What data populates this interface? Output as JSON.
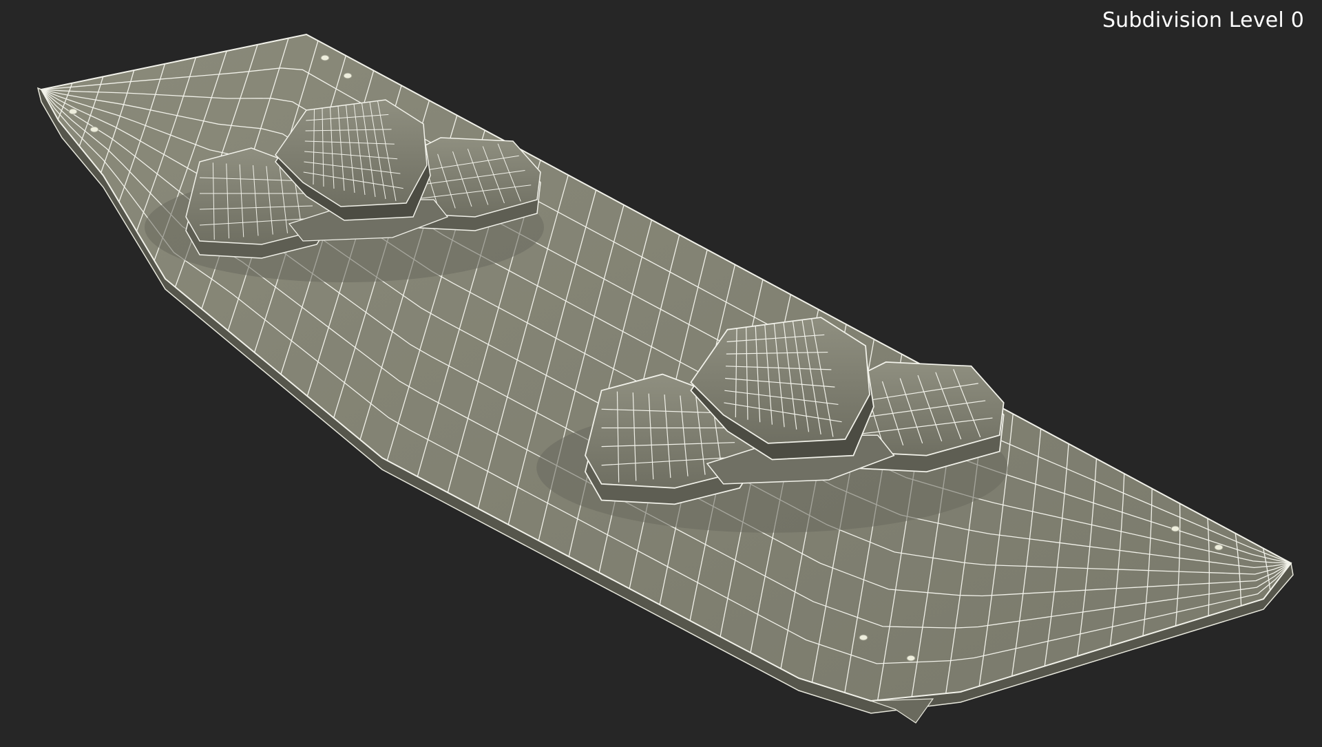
{
  "viewport": {
    "overlay_label": "Subdivision Level 0",
    "background_color": "#262626"
  },
  "model": {
    "subject": "kiteboard with two foot bindings",
    "surface_color": "#888878",
    "wire_color": "#f2f2ea",
    "screw_color": "#eeeedd"
  }
}
